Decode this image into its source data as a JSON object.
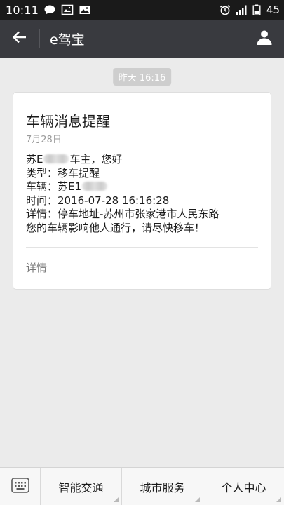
{
  "status_bar": {
    "time": "10:11",
    "battery_level": "45",
    "icons_left": [
      "chat-bubble-icon",
      "image-frame-icon",
      "picture-icon"
    ],
    "icons_right": [
      "alarm-icon",
      "signal-icon",
      "battery-icon"
    ]
  },
  "header": {
    "title": "e驾宝",
    "back_icon": "arrow-left-icon",
    "profile_icon": "person-icon"
  },
  "timestamp": "昨天 16:16",
  "card": {
    "title": "车辆消息提醒",
    "date": "7月28日",
    "greeting_prefix": "苏E",
    "greeting_suffix": "车主，您好",
    "type_line": "类型：移车提醒",
    "vehicle_prefix": "车辆：苏E1",
    "time_line": "时间：2016-07-28 16:16:28",
    "detail_line": "详情：停车地址-苏州市张家港市人民东路",
    "message_line": "您的车辆影响他人通行，请尽快移车！",
    "detail_link": "详情"
  },
  "bottom_nav": {
    "keyboard_icon": "keyboard-icon",
    "items": [
      {
        "label": "智能交通"
      },
      {
        "label": "城市服务"
      },
      {
        "label": "个人中心"
      }
    ]
  },
  "colors": {
    "status_bar_bg": "#1a1a1a",
    "header_bg": "#393a3f",
    "page_bg": "#ebebeb",
    "card_bg": "#ffffff",
    "timestamp_bg": "#cecece"
  }
}
